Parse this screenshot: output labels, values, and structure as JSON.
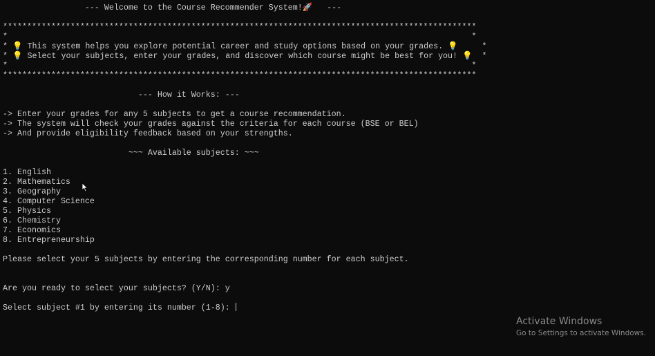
{
  "terminal": {
    "lines": [
      "                 --- Welcome to the Course Recommender System!🚀   ---",
      "",
      "**************************************************************************************************",
      "*                                                                                                *",
      "* 💡 This system helps you explore potential career and study options based on your grades. 💡     *",
      "* 💡 Select your subjects, enter your grades, and discover which course might be best for you! 💡  *",
      "*                                                                                                *",
      "**************************************************************************************************",
      "",
      "                            --- How it Works: ---",
      "",
      "-> Enter your grades for any 5 subjects to get a course recommendation.",
      "-> The system will check your grades against the criteria for each course (BSE or BEL)",
      "-> And provide eligibility feedback based on your strengths.",
      "",
      "                          ~~~ Available subjects: ~~~",
      "",
      "1. English",
      "2. Mathematics",
      "3. Geography",
      "4. Computer Science",
      "5. Physics",
      "6. Chemistry",
      "7. Economics",
      "8. Entrepreneurship",
      "",
      "Please select your 5 subjects by entering the corresponding number for each subject.",
      "",
      "",
      "Are you ready to select your subjects? (Y/N): y",
      "",
      "Select subject #1 by entering its number (1-8): "
    ]
  },
  "watermark": {
    "title": "Activate Windows",
    "subtitle": "Go to Settings to activate Windows."
  }
}
